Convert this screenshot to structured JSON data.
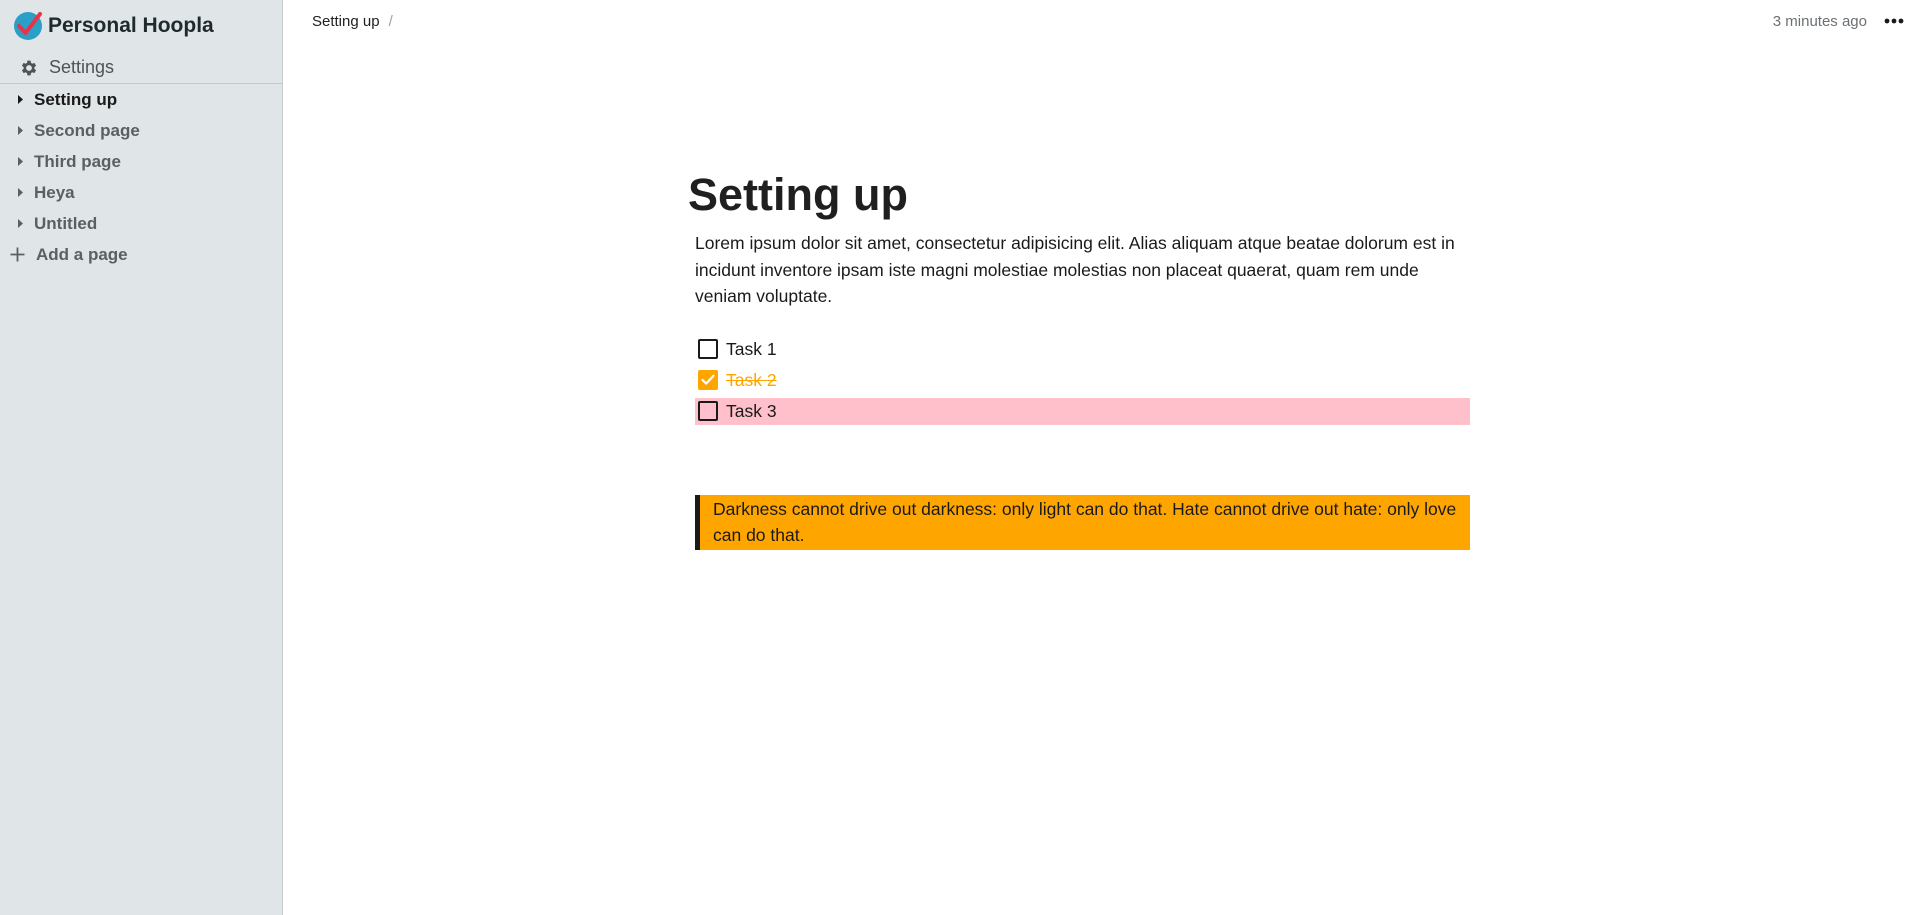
{
  "app": {
    "name": "Personal Hoopla"
  },
  "sidebar": {
    "settings_label": "Settings",
    "pages": [
      {
        "label": "Setting up",
        "active": true
      },
      {
        "label": "Second page",
        "active": false
      },
      {
        "label": "Third page",
        "active": false
      },
      {
        "label": "Heya",
        "active": false
      },
      {
        "label": "Untitled",
        "active": false
      }
    ],
    "add_page_label": "Add a page"
  },
  "topbar": {
    "breadcrumb": "Setting up",
    "breadcrumb_separator": "/",
    "timestamp": "3 minutes ago"
  },
  "document": {
    "title": "Setting up",
    "paragraph": "Lorem ipsum dolor sit amet, consectetur adipisicing elit. Alias aliquam atque beatae dolorum est in incidunt inventore ipsam iste magni molestiae molestias non placeat quaerat, quam rem unde veniam voluptate.",
    "tasks": [
      {
        "label": "Task 1",
        "checked": false,
        "highlight": false
      },
      {
        "label": "Task 2",
        "checked": true,
        "highlight": false
      },
      {
        "label": "Task 3",
        "checked": false,
        "highlight": true
      }
    ],
    "quote": "Darkness cannot drive out darkness: only light can do that. Hate cannot drive out hate: only love can do that."
  },
  "colors": {
    "sidebar_bg": "#e0e5e8",
    "accent": "#ffa500",
    "highlight": "#ffc0cb"
  },
  "icons": {
    "logo": "checkmark-logo-icon",
    "settings": "gear-icon",
    "page_toggle": "caret-right-icon",
    "add": "plus-icon",
    "more": "ellipsis-icon",
    "checked": "checkmark-icon"
  }
}
